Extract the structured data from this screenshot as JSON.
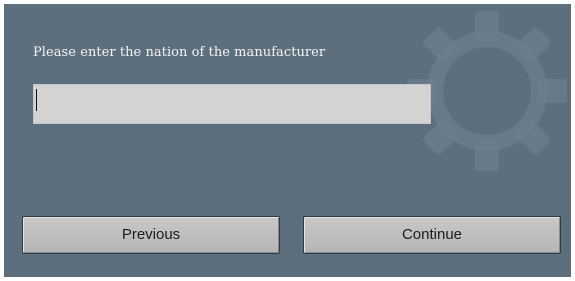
{
  "dialog": {
    "prompt": "Please enter the nation of the manufacturer",
    "input": {
      "value": "",
      "placeholder": ""
    },
    "buttons": {
      "previous_label": "Previous",
      "continue_label": "Continue"
    },
    "background_icon": "gear-icon"
  },
  "colors": {
    "panel_background": "#5d6f7d",
    "input_background": "#d3d3d3",
    "button_background": "#bdbdbd",
    "prompt_text": "#f2f5f7"
  }
}
